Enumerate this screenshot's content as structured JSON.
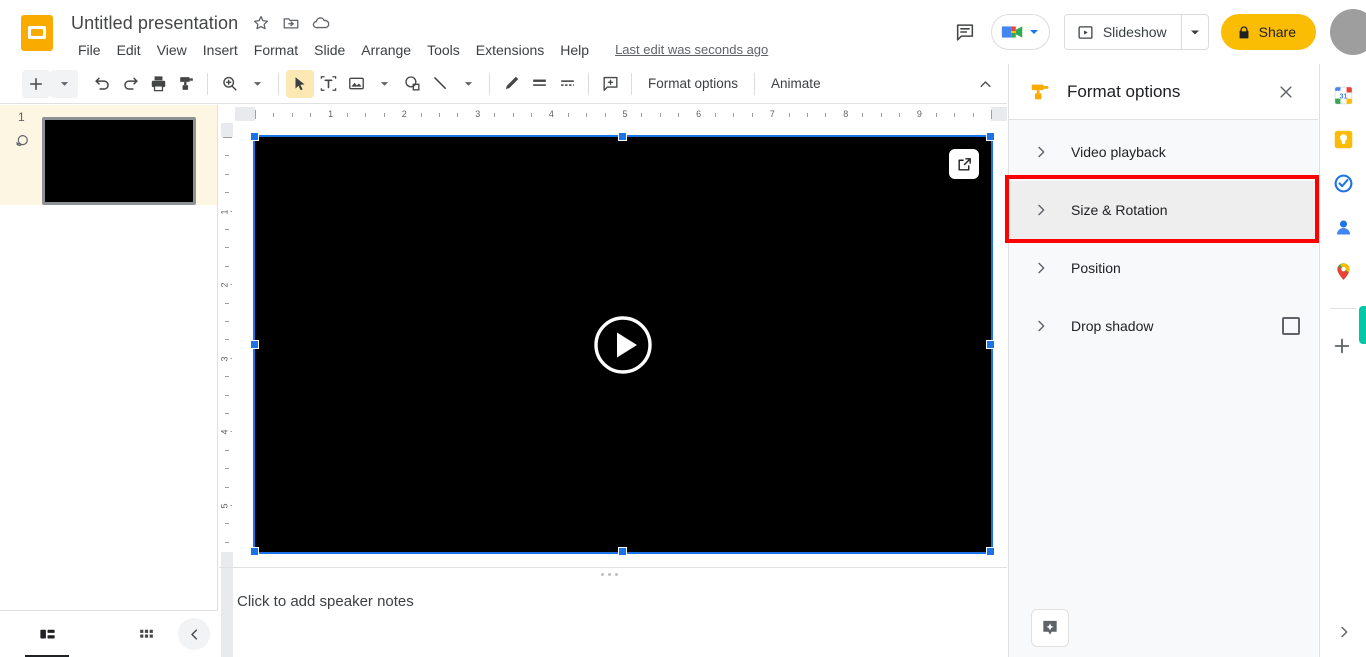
{
  "app": {
    "name": "Google Slides",
    "doc_title": "Untitled presentation",
    "last_edit": "Last edit was seconds ago"
  },
  "title_icons": [
    {
      "name": "star-icon",
      "glyph": "star"
    },
    {
      "name": "move-to-folder-icon",
      "glyph": "folder-move"
    },
    {
      "name": "cloud-saved-icon",
      "glyph": "cloud"
    }
  ],
  "menubar": {
    "items": [
      {
        "label": "File"
      },
      {
        "label": "Edit"
      },
      {
        "label": "View"
      },
      {
        "label": "Insert"
      },
      {
        "label": "Format"
      },
      {
        "label": "Slide"
      },
      {
        "label": "Arrange"
      },
      {
        "label": "Tools"
      },
      {
        "label": "Extensions"
      },
      {
        "label": "Help"
      }
    ]
  },
  "header_actions": {
    "comment_tooltip": "Open comment history",
    "meet_label": "Join a call",
    "slideshow_label": "Slideshow",
    "share_label": "Share",
    "avatar_label": "Account"
  },
  "toolbar": {
    "buttons": [
      {
        "name": "new-slide-button",
        "icon": "plus"
      },
      {
        "name": "new-slide-dropdown",
        "icon": "caret"
      },
      {
        "name": "undo-button",
        "icon": "undo"
      },
      {
        "name": "redo-button",
        "icon": "redo"
      },
      {
        "name": "print-button",
        "icon": "print"
      },
      {
        "name": "paint-format-button",
        "icon": "paint-format"
      },
      {
        "name": "zoom-button",
        "icon": "zoom"
      },
      {
        "name": "zoom-dropdown",
        "icon": "caret"
      },
      {
        "name": "select-tool-button",
        "icon": "cursor"
      },
      {
        "name": "text-box-button",
        "icon": "text-box"
      },
      {
        "name": "insert-image-button",
        "icon": "image"
      },
      {
        "name": "insert-image-dropdown",
        "icon": "caret"
      },
      {
        "name": "shape-button",
        "icon": "shape"
      },
      {
        "name": "line-button",
        "icon": "line"
      },
      {
        "name": "line-dropdown",
        "icon": "caret"
      },
      {
        "name": "fill-color-button",
        "icon": "pen"
      },
      {
        "name": "line-weight-button",
        "icon": "line-weight"
      },
      {
        "name": "line-dash-button",
        "icon": "line-dash"
      },
      {
        "name": "add-comment-button",
        "icon": "add-comment"
      }
    ],
    "format_options_label": "Format options",
    "animate_label": "Animate",
    "collapse_tooltip": "Hide the menus"
  },
  "filmstrip": {
    "slides": [
      {
        "number": "1",
        "has_transition": true,
        "selected": true
      }
    ],
    "view_filmstrip_label": "Filmstrip view",
    "view_grid_label": "Grid view",
    "collapse_label": "Hide filmstrip"
  },
  "canvas": {
    "ruler_h_labels": [
      "1",
      "2",
      "3",
      "4",
      "5",
      "6",
      "7",
      "8",
      "9"
    ],
    "ruler_v_labels": [
      "1",
      "2",
      "3",
      "4",
      "5"
    ],
    "video": {
      "selected": true,
      "play_button_name": "play-button",
      "popout_button_name": "open-in-new-button"
    },
    "notes_placeholder": "Click to add speaker notes"
  },
  "format_panel": {
    "title": "Format options",
    "close_label": "Close",
    "rows": [
      {
        "label": "Video playback",
        "name": "video-playback",
        "highlighted": false,
        "has_checkbox": false
      },
      {
        "label": "Size & Rotation",
        "name": "size-and-rotation",
        "highlighted": true,
        "has_checkbox": false
      },
      {
        "label": "Position",
        "name": "position",
        "highlighted": false,
        "has_checkbox": false
      },
      {
        "label": "Drop shadow",
        "name": "drop-shadow",
        "highlighted": false,
        "has_checkbox": true
      }
    ],
    "annotation": {
      "color": "#ff0000",
      "target": "Size & Rotation"
    }
  },
  "right_rail": {
    "items": [
      {
        "name": "google-calendar-icon",
        "label": "Calendar",
        "badge": "31"
      },
      {
        "name": "google-keep-icon",
        "label": "Keep"
      },
      {
        "name": "google-tasks-icon",
        "label": "Tasks"
      },
      {
        "name": "google-contacts-icon",
        "label": "Contacts"
      },
      {
        "name": "google-maps-icon",
        "label": "Maps"
      }
    ],
    "add_on_label": "Get Add-ons",
    "expand_label": "Show side panel"
  },
  "colors": {
    "brand_yellow": "#fbbc04",
    "selection_blue": "#1a73e8",
    "annotation_red": "#ff0000",
    "slide_black": "#000000",
    "panel_bg": "#f8f9fa",
    "highlight_gray": "#eeeeee"
  }
}
